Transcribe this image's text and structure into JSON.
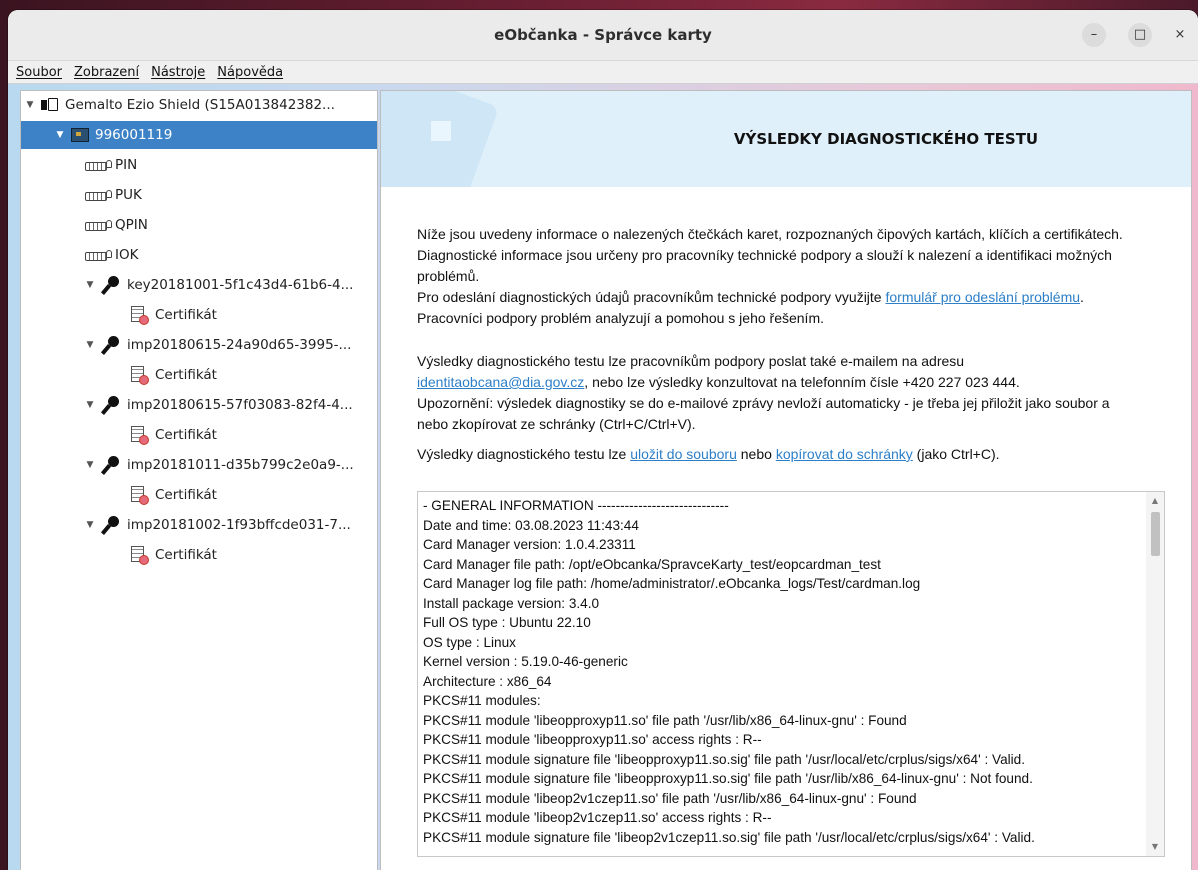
{
  "window": {
    "title": "eObčanka - Správce karty",
    "controls": {
      "minimize": "–",
      "maximize": "□",
      "close": "×"
    }
  },
  "menu": [
    "Soubor",
    "Zobrazení",
    "Nástroje",
    "Nápověda"
  ],
  "tree": {
    "reader": "Gemalto Ezio Shield (S15A013842382...",
    "card": "996001119",
    "pins": [
      "PIN",
      "PUK",
      "QPIN",
      "IOK"
    ],
    "keys": [
      {
        "label": "key20181001-5f1c43d4-61b6-4...",
        "child": "Certifikát"
      },
      {
        "label": "imp20180615-24a90d65-3995-...",
        "child": "Certifikát"
      },
      {
        "label": "imp20180615-57f03083-82f4-4...",
        "child": "Certifikát"
      },
      {
        "label": "imp20181011-d35b799c2e0a9-...",
        "child": "Certifikát"
      },
      {
        "label": "imp20181002-1f93bffcde031-7...",
        "child": "Certifikát"
      }
    ]
  },
  "main": {
    "heading": "VÝSLEDKY DIAGNOSTICKÉHO TESTU",
    "p1_line1": "Níže jsou uvedeny informace o nalezených čtečkách karet, rozpoznaných čipových kartách, klíčích a certifikátech.",
    "p1_line2": "Diagnostické informace jsou určeny pro pracovníky technické podpory a slouží k nalezení a identifikaci možných",
    "p1_line3": "problémů.",
    "p1_line4a": "Pro odeslání diagnostických údajů pracovníkům technické podpory využijte ",
    "p1_link": "formulář pro odeslání problému",
    "p1_line4b": ".",
    "p1_line5": "Pracovníci podpory problém analyzují a pomohou s jeho řešením.",
    "p2_line1": "Výsledky diagnostického testu lze pracovníkům podpory poslat také e-mailem na adresu",
    "p2_email": "identitaobcana@dia.gov.cz",
    "p2_line2b": ", nebo lze výsledky konzultovat na telefonním čísle +420 227 023 444.",
    "p2_line3": "Upozornění: výsledek diagnostiky se do e-mailové zprávy nevloží automaticky - je třeba jej přiložit jako soubor a",
    "p2_line4": "nebo zkopírovat ze schránky (Ctrl+C/Ctrl+V).",
    "p3_a": "Výsledky diagnostického testu lze ",
    "p3_link1": "uložit do souboru",
    "p3_b": " nebo ",
    "p3_link2": "kopírovat do schránky",
    "p3_c": " (jako Ctrl+C).",
    "log_lines": [
      "- GENERAL INFORMATION -----------------------------",
      "Date and time: 03.08.2023 11:43:44",
      "Card Manager version: 1.0.4.23311",
      "Card Manager file path: /opt/eObcanka/SpravceKarty_test/eopcardman_test",
      "Card Manager log file path: /home/administrator/.eObcanka_logs/Test/cardman.log",
      "Install package version: 3.4.0",
      "Full OS type : Ubuntu 22.10",
      "OS type : Linux",
      "Kernel version : 5.19.0-46-generic",
      "Architecture : x86_64",
      "PKCS#11 modules:",
      "PKCS#11 module 'libeopproxyp11.so' file path '/usr/lib/x86_64-linux-gnu' : Found",
      "PKCS#11 module 'libeopproxyp11.so' access rights : R--",
      "PKCS#11 module signature file 'libeopproxyp11.so.sig' file path '/usr/local/etc/crplus/sigs/x64' : Valid.",
      "PKCS#11 module signature file 'libeopproxyp11.so.sig' file path '/usr/lib/x86_64-linux-gnu' : Not found.",
      "PKCS#11 module 'libeop2v1czep11.so' file path '/usr/lib/x86_64-linux-gnu' : Found",
      "PKCS#11 module 'libeop2v1czep11.so' access rights : R--",
      "PKCS#11 module signature file 'libeop2v1czep11.so.sig' file path '/usr/local/etc/crplus/sigs/x64' : Valid."
    ]
  }
}
